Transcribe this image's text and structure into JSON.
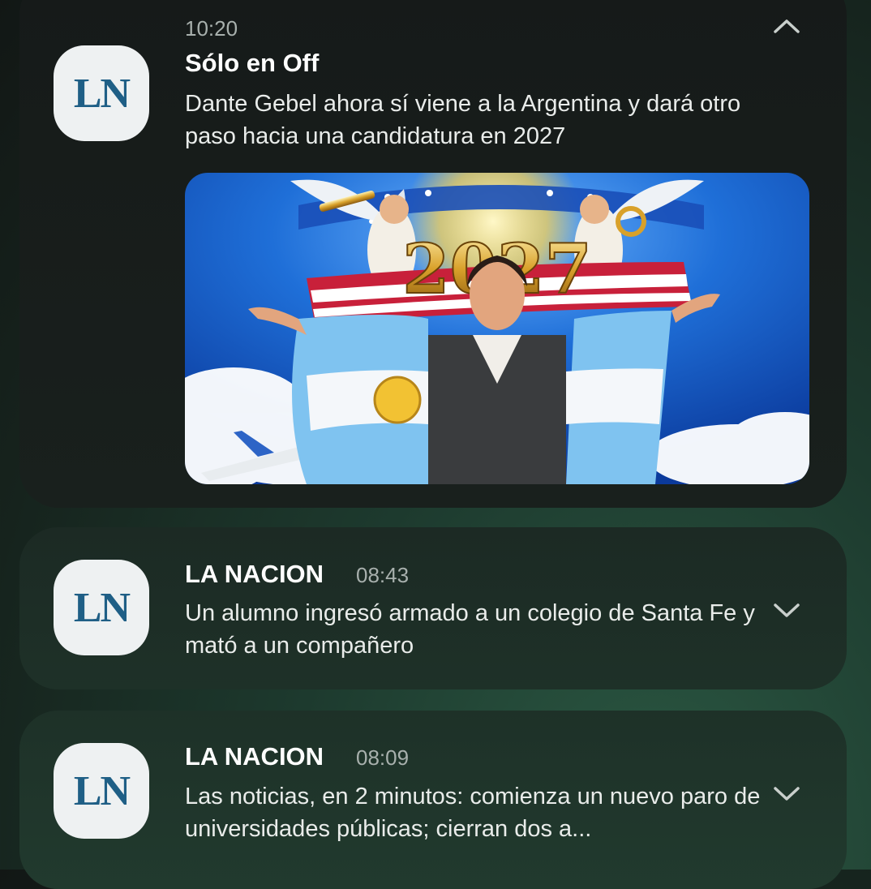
{
  "notifications": [
    {
      "icon": "ln-logo",
      "icon_text": "LN",
      "time": "10:20",
      "title": "Sólo en Off",
      "body": "Dante Gebel ahora sí viene a la Argentina y dará otro paso hacia una candidatura en 2027",
      "image_text": "2027",
      "chevron": "chevron-up-icon"
    },
    {
      "icon": "ln-logo",
      "icon_text": "LN",
      "app": "LA NACION",
      "time": "08:43",
      "body": "Un alumno ingresó armado a un colegio de Santa Fe y mató a un compañero",
      "chevron": "chevron-down-icon"
    },
    {
      "icon": "ln-logo",
      "icon_text": "LN",
      "app": "LA NACION",
      "time": "08:09",
      "body": "Las noticias, en 2 minutos: comienza un nuevo paro de universidades públicas; cierran dos a...",
      "chevron": "chevron-down-icon"
    }
  ],
  "colors": {
    "logo_blue": "#1f5f86",
    "logo_bg": "#eef1f2",
    "card_dark": "#161a19",
    "card_green": "#1e3128"
  }
}
